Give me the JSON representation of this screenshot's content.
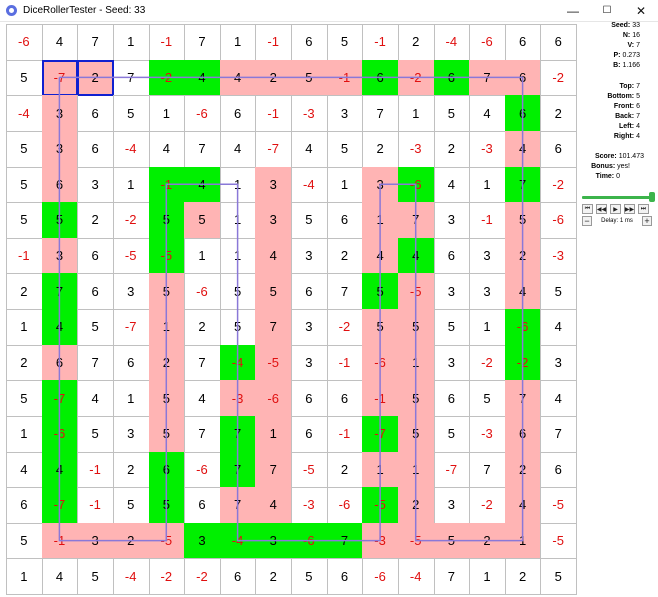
{
  "window": {
    "title": "DiceRollerTester - Seed: 33",
    "minimize": "—",
    "maximize": "☐",
    "close": "✕"
  },
  "grid": {
    "rows": [
      [
        -6,
        4,
        7,
        1,
        -1,
        7,
        1,
        -1,
        6,
        5,
        -1,
        2,
        -4,
        -6,
        6,
        6
      ],
      [
        5,
        -7,
        2,
        7,
        -2,
        4,
        4,
        2,
        5,
        -1,
        6,
        -2,
        6,
        7,
        6,
        -2
      ],
      [
        -4,
        3,
        6,
        5,
        1,
        -6,
        6,
        -1,
        -3,
        3,
        7,
        1,
        5,
        4,
        6,
        2
      ],
      [
        5,
        3,
        6,
        -4,
        4,
        7,
        4,
        -7,
        4,
        5,
        2,
        -3,
        2,
        -3,
        4,
        6
      ],
      [
        5,
        6,
        3,
        1,
        -1,
        4,
        1,
        3,
        -4,
        1,
        3,
        -6,
        4,
        1,
        7,
        -2
      ],
      [
        5,
        5,
        2,
        -2,
        5,
        5,
        1,
        3,
        5,
        6,
        1,
        7,
        3,
        -1,
        5,
        -6
      ],
      [
        -1,
        3,
        6,
        -5,
        -5,
        1,
        1,
        4,
        3,
        2,
        4,
        4,
        6,
        3,
        2,
        -3
      ],
      [
        2,
        7,
        6,
        3,
        5,
        -6,
        5,
        5,
        6,
        7,
        5,
        -5,
        3,
        3,
        4,
        5
      ],
      [
        1,
        4,
        5,
        -7,
        1,
        2,
        5,
        7,
        3,
        -2,
        5,
        5,
        5,
        1,
        -6,
        4
      ],
      [
        2,
        6,
        7,
        6,
        2,
        7,
        -4,
        -5,
        3,
        -1,
        -6,
        1,
        3,
        -2,
        -2,
        3
      ],
      [
        5,
        -7,
        4,
        1,
        5,
        4,
        -3,
        -6,
        6,
        6,
        -1,
        5,
        6,
        5,
        7,
        4
      ],
      [
        1,
        -6,
        5,
        3,
        5,
        7,
        7,
        1,
        6,
        -1,
        -7,
        5,
        5,
        -3,
        6,
        7
      ],
      [
        4,
        4,
        -1,
        2,
        6,
        -6,
        7,
        7,
        -5,
        2,
        1,
        1,
        -7,
        7,
        2,
        6
      ],
      [
        6,
        -7,
        -1,
        5,
        5,
        6,
        7,
        4,
        -3,
        -6,
        -5,
        2,
        3,
        -2,
        4,
        -5
      ],
      [
        5,
        -1,
        3,
        2,
        -5,
        3,
        -4,
        3,
        -6,
        7,
        -3,
        -5,
        5,
        2,
        1,
        -5
      ],
      [
        1,
        4,
        5,
        -4,
        -2,
        -2,
        6,
        2,
        5,
        6,
        -6,
        -4,
        7,
        1,
        2,
        5
      ]
    ],
    "fills": [
      "................",
      ".pp.ggppppgpgpp.",
      ".p............g.",
      ".p............p.",
      ".p..gg.p..pg..g.",
      ".g..gp.p..pp..p.",
      ".p..g..p..pg..p.",
      ".g..p..p..gp..p.",
      ".g..p..p..pp..g.",
      ".p..p.gp..pp..g.",
      ".g..p.pp..pp..p.",
      ".g..p.gp..gp..p.",
      ".g..g.gp..pp..p.",
      ".g..g.pp..gp..p.",
      ".ppppgggggppppp.",
      "................"
    ],
    "selected_row": 1,
    "selected_cols": [
      1,
      2
    ],
    "path_color": "#8a78d8",
    "path": [
      [
        1,
        1
      ],
      [
        14,
        1
      ],
      [
        14,
        14
      ],
      [
        11,
        14
      ],
      [
        11,
        4
      ],
      [
        10,
        4
      ],
      [
        10,
        14
      ],
      [
        6,
        14
      ],
      [
        6,
        4
      ],
      [
        4,
        4
      ],
      [
        4,
        14
      ],
      [
        1,
        14
      ],
      [
        1,
        1
      ]
    ]
  },
  "stats": {
    "seed": {
      "label": "Seed:",
      "value": "33"
    },
    "n": {
      "label": "N:",
      "value": "16"
    },
    "v": {
      "label": "V:",
      "value": "7"
    },
    "p": {
      "label": "P:",
      "value": "0.273"
    },
    "b": {
      "label": "B:",
      "value": "1.166"
    },
    "top": {
      "label": "Top:",
      "value": "7"
    },
    "bottom": {
      "label": "Bottom:",
      "value": "5"
    },
    "front": {
      "label": "Front:",
      "value": "6"
    },
    "back": {
      "label": "Back:",
      "value": "7"
    },
    "left": {
      "label": "Left:",
      "value": "4"
    },
    "right": {
      "label": "Right:",
      "value": "4"
    },
    "score": {
      "label": "Score:",
      "value": "101.473"
    },
    "bonus": {
      "label": "Bonus:",
      "value": "yes!"
    },
    "time": {
      "label": "Time:",
      "value": "0"
    }
  },
  "playback": {
    "slider_fraction": 1.0,
    "buttons": [
      "⏮",
      "◀◀",
      "▶",
      "▶▶",
      "⏭"
    ],
    "delay_label": "Delay: 1 ms",
    "minus": "−",
    "plus": "+"
  },
  "colors": {
    "green": "#00f000",
    "pink": "#ffb4b4",
    "negative": "#e01010",
    "selection": "#1020d0",
    "slider": "#3cb44b"
  }
}
